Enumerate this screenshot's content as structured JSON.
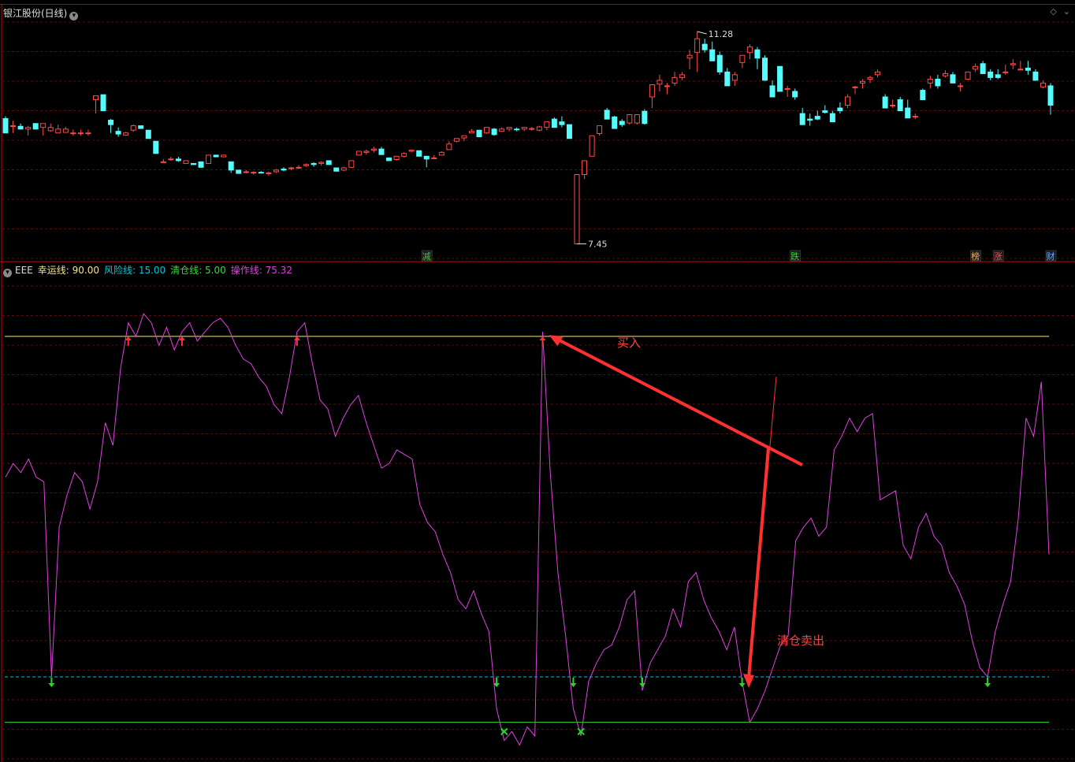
{
  "header": {
    "title": "银江股份(日线)"
  },
  "indicator": {
    "name": "EEE",
    "lucky_label": "幸运线: 90.00",
    "risk_label": "风险线: 15.00",
    "clear_label": "清仓线: 5.00",
    "op_label": "操作线: 75.32",
    "colors": {
      "lucky": "#f2e78a",
      "risk": "#00c8d8",
      "clear": "#33dd33",
      "op": "#e040e0"
    }
  },
  "colors": {
    "up": "#ff4a4a",
    "down": "#54fcfc",
    "grid": "#7a0000",
    "axis": "#c80000"
  },
  "annotations": {
    "buy": "买入",
    "sell": "清仓卖出",
    "max_label": "11.28",
    "min_label": "7.45"
  },
  "event_tags": [
    {
      "label": "减",
      "color": "#3ccf3c"
    },
    {
      "label": "跌",
      "color": "#3ccf3c"
    },
    {
      "label": "榜",
      "color": "#ffb347"
    },
    {
      "label": "涨",
      "color": "#ff5050"
    },
    {
      "label": "财",
      "color": "#6aa8ff"
    }
  ],
  "chart_data": [
    {
      "type": "candlestick",
      "title": "银江股份(日线)",
      "ylim": [
        7.3,
        11.45
      ],
      "max": 11.28,
      "min": 7.45,
      "ohlc": [
        [
          9.71,
          9.75,
          9.45,
          9.45
        ],
        [
          9.58,
          9.67,
          9.45,
          9.58
        ],
        [
          9.57,
          9.62,
          9.51,
          9.52
        ],
        [
          9.52,
          9.58,
          9.4,
          9.55
        ],
        [
          9.62,
          9.62,
          9.51,
          9.52
        ],
        [
          9.55,
          9.62,
          9.4,
          9.62
        ],
        [
          9.49,
          9.62,
          9.47,
          9.55
        ],
        [
          9.45,
          9.6,
          9.45,
          9.52
        ],
        [
          9.46,
          9.56,
          9.45,
          9.52
        ],
        [
          9.45,
          9.51,
          9.4,
          9.45
        ],
        [
          9.45,
          9.51,
          9.4,
          9.45
        ],
        [
          9.45,
          9.51,
          9.4,
          9.45
        ],
        [
          10.05,
          10.12,
          9.8,
          10.12
        ],
        [
          10.14,
          10.14,
          9.85,
          9.85
        ],
        [
          9.68,
          9.7,
          9.45,
          9.6
        ],
        [
          9.48,
          9.55,
          9.38,
          9.43
        ],
        [
          9.41,
          9.47,
          9.4,
          9.45
        ],
        [
          9.5,
          9.6,
          9.47,
          9.58
        ],
        [
          9.58,
          9.58,
          9.53,
          9.53
        ],
        [
          9.5,
          9.5,
          9.35,
          9.35
        ],
        [
          9.3,
          9.3,
          9.08,
          9.08
        ],
        [
          8.93,
          8.98,
          8.93,
          8.93
        ],
        [
          8.97,
          9.02,
          8.95,
          8.98
        ],
        [
          8.98,
          9.02,
          8.93,
          8.95
        ],
        [
          8.9,
          8.9,
          8.91,
          8.95
        ],
        [
          8.9,
          8.9,
          8.88,
          8.88
        ],
        [
          8.93,
          8.93,
          8.83,
          8.83
        ],
        [
          8.9,
          9.05,
          8.9,
          9.05
        ],
        [
          9.05,
          9.05,
          9.01,
          9.02
        ],
        [
          9.02,
          9.05,
          9.01,
          9.05
        ],
        [
          8.93,
          8.93,
          8.73,
          8.78
        ],
        [
          8.78,
          8.78,
          8.72,
          8.72
        ],
        [
          8.74,
          8.78,
          8.72,
          8.75
        ],
        [
          8.73,
          8.76,
          8.7,
          8.74
        ],
        [
          8.74,
          8.76,
          8.72,
          8.73
        ],
        [
          8.73,
          8.75,
          8.68,
          8.73
        ],
        [
          8.75,
          8.8,
          8.73,
          8.78
        ],
        [
          8.8,
          8.83,
          8.76,
          8.78
        ],
        [
          8.82,
          8.84,
          8.78,
          8.82
        ],
        [
          8.83,
          8.87,
          8.8,
          8.83
        ],
        [
          8.86,
          8.9,
          8.84,
          8.88
        ],
        [
          8.9,
          8.92,
          8.84,
          8.88
        ],
        [
          8.9,
          8.94,
          8.86,
          8.92
        ],
        [
          8.95,
          8.95,
          8.88,
          8.88
        ],
        [
          8.82,
          8.82,
          8.76,
          8.76
        ],
        [
          8.78,
          8.84,
          8.76,
          8.82
        ],
        [
          8.83,
          8.95,
          8.83,
          8.95
        ],
        [
          9.05,
          9.12,
          9.05,
          9.12
        ],
        [
          9.1,
          9.15,
          9.06,
          9.12
        ],
        [
          9.14,
          9.2,
          9.1,
          9.16
        ],
        [
          9.16,
          9.2,
          9.06,
          9.06
        ],
        [
          9.0,
          9.0,
          8.95,
          8.95
        ],
        [
          8.97,
          9.03,
          8.95,
          9.03
        ],
        [
          9.03,
          9.1,
          9.01,
          9.08
        ],
        [
          9.12,
          9.14,
          9.1,
          9.14
        ],
        [
          9.13,
          9.13,
          9.03,
          9.03
        ],
        [
          9.03,
          9.03,
          8.83,
          8.98
        ],
        [
          9.0,
          9.05,
          8.99,
          9.0
        ],
        [
          9.05,
          9.12,
          9.05,
          9.1
        ],
        [
          9.15,
          9.3,
          9.15,
          9.25
        ],
        [
          9.3,
          9.35,
          9.28,
          9.35
        ],
        [
          9.36,
          9.4,
          9.3,
          9.4
        ],
        [
          9.45,
          9.52,
          9.45,
          9.48
        ],
        [
          9.5,
          9.5,
          9.38,
          9.38
        ],
        [
          9.45,
          9.55,
          9.43,
          9.55
        ],
        [
          9.52,
          9.54,
          9.4,
          9.42
        ],
        [
          9.48,
          9.55,
          9.48,
          9.52
        ],
        [
          9.52,
          9.55,
          9.48,
          9.55
        ],
        [
          9.52,
          9.55,
          9.48,
          9.51
        ],
        [
          9.52,
          9.55,
          9.48,
          9.55
        ],
        [
          9.53,
          9.56,
          9.49,
          9.53
        ],
        [
          9.5,
          9.58,
          9.48,
          9.56
        ],
        [
          9.55,
          9.65,
          9.5,
          9.65
        ],
        [
          9.7,
          9.73,
          9.55,
          9.55
        ],
        [
          9.65,
          9.75,
          9.55,
          9.6
        ],
        [
          9.6,
          9.6,
          9.35,
          9.35
        ],
        [
          7.45,
          8.7,
          7.45,
          8.7
        ],
        [
          8.7,
          8.95,
          8.62,
          8.95
        ],
        [
          9.03,
          9.4,
          9.03,
          9.4
        ],
        [
          9.44,
          9.58,
          9.4,
          9.58
        ],
        [
          9.86,
          9.9,
          9.7,
          9.7
        ],
        [
          9.74,
          9.76,
          9.53,
          9.53
        ],
        [
          9.66,
          9.7,
          9.56,
          9.6
        ],
        [
          9.63,
          9.78,
          9.6,
          9.78
        ],
        [
          9.63,
          9.78,
          9.6,
          9.78
        ],
        [
          9.84,
          9.88,
          9.6,
          9.62
        ],
        [
          10.1,
          10.32,
          9.9,
          10.32
        ],
        [
          10.33,
          10.5,
          10.2,
          10.4
        ],
        [
          10.3,
          10.35,
          10.15,
          10.3
        ],
        [
          10.35,
          10.55,
          10.3,
          10.45
        ],
        [
          10.45,
          10.55,
          10.4,
          10.5
        ],
        [
          10.8,
          10.95,
          10.6,
          10.85
        ],
        [
          10.9,
          11.28,
          10.55,
          11.15
        ],
        [
          11.05,
          11.15,
          10.9,
          10.95
        ],
        [
          10.95,
          11.1,
          10.75,
          10.75
        ],
        [
          10.85,
          10.92,
          10.5,
          10.55
        ],
        [
          10.55,
          10.62,
          10.3,
          10.3
        ],
        [
          10.4,
          10.55,
          10.3,
          10.5
        ],
        [
          10.72,
          10.85,
          10.62,
          10.85
        ],
        [
          10.9,
          11.05,
          10.78,
          11.0
        ],
        [
          10.95,
          11.0,
          10.6,
          10.8
        ],
        [
          10.8,
          10.85,
          10.4,
          10.4
        ],
        [
          10.3,
          10.4,
          10.1,
          10.1
        ],
        [
          10.65,
          10.65,
          10.2,
          10.2
        ],
        [
          10.25,
          10.3,
          10.1,
          10.25
        ],
        [
          10.2,
          10.25,
          10.05,
          10.1
        ],
        [
          9.8,
          9.9,
          9.6,
          9.6
        ],
        [
          9.7,
          9.8,
          9.58,
          9.68
        ],
        [
          9.75,
          9.85,
          9.68,
          9.7
        ],
        [
          9.85,
          9.95,
          9.8,
          9.82
        ],
        [
          9.8,
          9.85,
          9.65,
          9.65
        ],
        [
          9.9,
          10.0,
          9.8,
          9.85
        ],
        [
          9.95,
          10.15,
          9.9,
          10.1
        ],
        [
          10.28,
          10.3,
          10.15,
          10.28
        ],
        [
          10.35,
          10.42,
          10.25,
          10.38
        ],
        [
          10.42,
          10.48,
          10.35,
          10.45
        ],
        [
          10.5,
          10.6,
          10.45,
          10.55
        ],
        [
          10.1,
          10.15,
          9.9,
          9.9
        ],
        [
          9.95,
          10.05,
          9.9,
          9.95
        ],
        [
          10.05,
          10.1,
          9.85,
          9.85
        ],
        [
          9.9,
          10.05,
          9.72,
          9.72
        ],
        [
          9.75,
          9.8,
          9.7,
          9.75
        ],
        [
          10.22,
          10.25,
          10.05,
          10.05
        ],
        [
          10.35,
          10.48,
          10.25,
          10.42
        ],
        [
          10.42,
          10.5,
          10.25,
          10.3
        ],
        [
          10.48,
          10.58,
          10.45,
          10.52
        ],
        [
          10.5,
          10.55,
          10.35,
          10.35
        ],
        [
          10.3,
          10.35,
          10.2,
          10.3
        ],
        [
          10.42,
          10.55,
          10.4,
          10.55
        ],
        [
          10.6,
          10.7,
          10.55,
          10.65
        ],
        [
          10.7,
          10.75,
          10.52,
          10.52
        ],
        [
          10.55,
          10.6,
          10.4,
          10.45
        ],
        [
          10.5,
          10.6,
          10.42,
          10.45
        ],
        [
          10.55,
          10.68,
          10.5,
          10.55
        ],
        [
          10.68,
          10.78,
          10.6,
          10.7
        ],
        [
          10.6,
          10.75,
          10.58,
          10.6
        ],
        [
          10.62,
          10.75,
          10.5,
          10.58
        ],
        [
          10.55,
          10.6,
          10.4,
          10.4
        ],
        [
          10.28,
          10.4,
          10.25,
          10.35
        ],
        [
          10.3,
          10.35,
          9.78,
          9.95
        ]
      ]
    },
    {
      "type": "line",
      "title": "EEE",
      "ylim": [
        -2,
        103
      ],
      "series": [
        {
          "name": "操作线",
          "color": "#e040e0",
          "values": [
            59,
            62,
            60,
            63,
            59,
            58,
            15,
            48,
            55,
            60,
            58,
            52,
            58,
            71,
            66,
            83,
            93,
            90,
            95,
            93,
            88,
            92,
            87,
            91,
            93,
            89,
            91,
            93,
            94,
            92,
            88,
            85,
            84,
            81,
            79,
            75,
            73,
            81,
            91,
            93,
            84,
            76,
            74,
            68,
            72,
            75,
            77,
            71,
            66,
            61,
            62,
            65,
            64,
            63,
            53,
            49,
            47,
            42,
            38,
            32,
            30,
            34,
            29,
            25,
            8,
            1,
            3,
            0,
            4,
            2,
            91,
            60,
            38,
            24,
            8,
            2,
            14,
            18,
            21,
            22,
            26,
            32,
            34,
            12,
            18,
            21,
            24,
            30,
            26,
            36,
            38,
            32,
            28,
            25,
            21,
            26,
            14,
            5,
            8,
            12,
            17,
            22,
            24,
            45,
            48,
            50,
            46,
            48,
            65,
            68,
            72,
            69,
            72,
            73,
            54,
            55,
            56,
            44,
            41,
            48,
            51,
            46,
            44,
            38,
            35,
            31,
            23,
            17,
            15,
            25,
            31,
            36,
            50,
            72,
            68,
            80,
            42
          ]
        },
        {
          "name": "幸运线",
          "color": "#f2e78a",
          "values": [
            90
          ]
        },
        {
          "name": "风险线",
          "color": "#00c8d8",
          "values": [
            15
          ]
        },
        {
          "name": "清仓线",
          "color": "#33dd33",
          "values": [
            5
          ]
        }
      ],
      "legend": "top-left",
      "grid": true
    }
  ]
}
